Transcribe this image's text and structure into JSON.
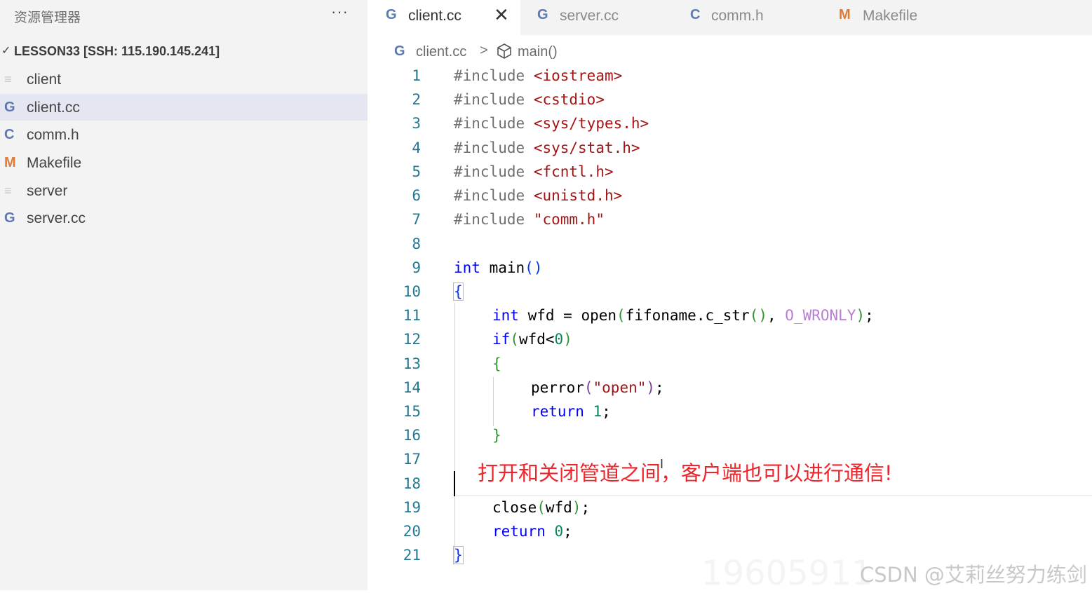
{
  "sidebar": {
    "title": "资源管理器",
    "more": "···",
    "root": "LESSON33 [SSH: 115.190.145.241]",
    "items": [
      {
        "icon": "≡",
        "label": "client"
      },
      {
        "icon": "G",
        "label": "client.cc"
      },
      {
        "icon": "C",
        "label": "comm.h"
      },
      {
        "icon": "M",
        "label": "Makefile"
      },
      {
        "icon": "≡",
        "label": "server"
      },
      {
        "icon": "G",
        "label": "server.cc"
      }
    ]
  },
  "tabs": [
    {
      "icon": "G",
      "label": "client.cc",
      "close": "✕"
    },
    {
      "icon": "G",
      "label": "server.cc"
    },
    {
      "icon": "C",
      "label": "comm.h"
    },
    {
      "icon": "M",
      "label": "Makefile"
    }
  ],
  "breadcrumb": {
    "icon": "G",
    "file": "client.cc",
    "sep": ">",
    "symbol": "main()"
  },
  "code": {
    "lines": [
      "1",
      "2",
      "3",
      "4",
      "5",
      "6",
      "7",
      "8",
      "9",
      "10",
      "11",
      "12",
      "13",
      "14",
      "15",
      "16",
      "17",
      "18",
      "19",
      "20",
      "21"
    ],
    "include": "#include",
    "inc1": "<iostream>",
    "inc2": "<cstdio>",
    "inc3": "<sys/types.h>",
    "inc4": "<sys/stat.h>",
    "inc5": "<fcntl.h>",
    "inc6": "<unistd.h>",
    "inc7": "\"comm.h\"",
    "kw_int": "int",
    "kw_if": "if",
    "kw_return": "return",
    "main": " main",
    "paren_open": "(",
    "paren_close": ")",
    "brace_open": "{",
    "brace_close": "}",
    "l11_mid": " wfd = open",
    "l11_call": "fifoname.c_str",
    "l11_empty_call": "()",
    "l11_comma": ", ",
    "l11_macro": "O_WRONLY",
    "semi": ";",
    "l12_cond": "wfd<",
    "zero": "0",
    "one": "1",
    "l14_fn": "perror",
    "l14_str": "\"open\"",
    "l19": "close",
    "l19_arg": "wfd",
    "space": " "
  },
  "annotation": "打开和关闭管道之间，客户端也可以进行通信!",
  "watermark": "CSDN @艾莉丝努力练剑",
  "watermark_faint": "19605911"
}
